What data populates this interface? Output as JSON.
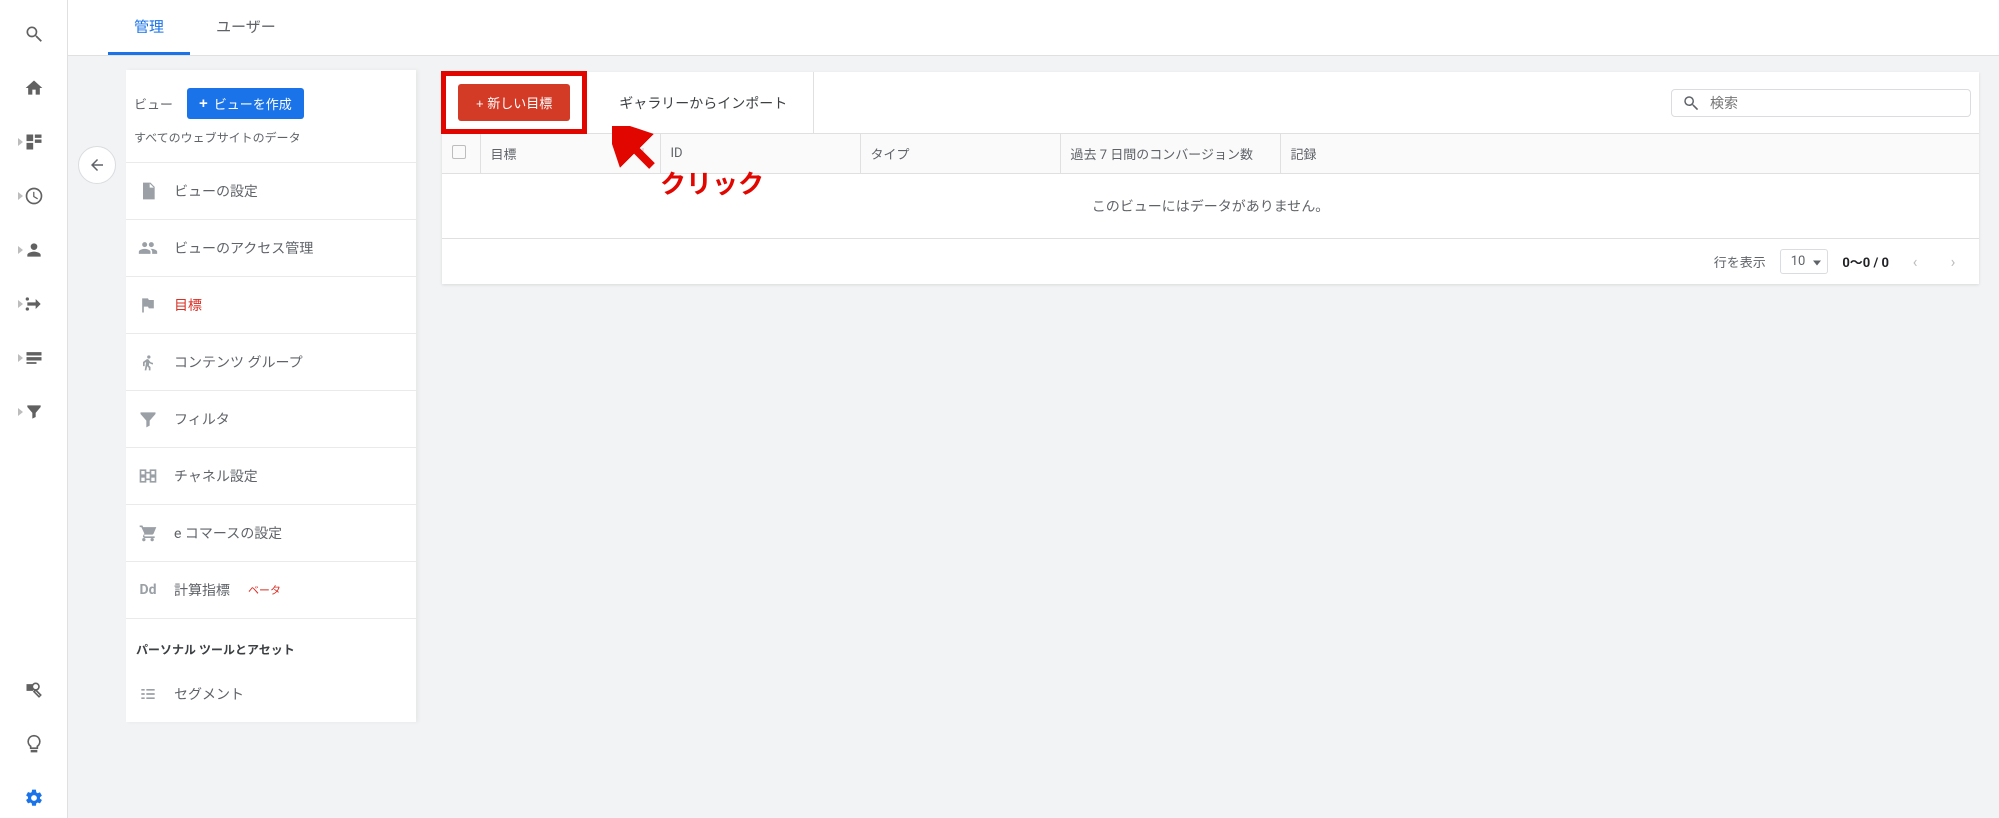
{
  "tabs": {
    "admin": "管理",
    "user": "ユーザー"
  },
  "rail": {
    "search": "search",
    "home": "home",
    "custom": "customization",
    "realtime": "realtime",
    "audience": "audience",
    "acquisition": "acquisition",
    "behavior": "behavior",
    "conversions": "conversions",
    "discover": "discover",
    "insights": "insights",
    "admin": "admin"
  },
  "side": {
    "view_label": "ビュー",
    "create_view": "ビューを作成",
    "subtitle": "すべてのウェブサイトのデータ",
    "items": [
      {
        "label": "ビューの設定"
      },
      {
        "label": "ビューのアクセス管理"
      },
      {
        "label": "目標"
      },
      {
        "label": "コンテンツ グループ"
      },
      {
        "label": "フィルタ"
      },
      {
        "label": "チャネル設定"
      },
      {
        "label": "e コマースの設定"
      },
      {
        "label": "計算指標",
        "beta": "ベータ"
      }
    ],
    "section_personal": "パーソナル ツールとアセット",
    "segments": "セグメント"
  },
  "toolbar": {
    "new_goal": "+ 新しい目標",
    "import": "ギャラリーからインポート",
    "search_placeholder": "検索"
  },
  "table": {
    "cols": {
      "goal": "目標",
      "id": "ID",
      "type": "タイプ",
      "conv": "過去 7 日間のコンバージョン数",
      "rec": "記録"
    },
    "empty": "このビューにはデータがありません。"
  },
  "pager": {
    "rows_label": "行を表示",
    "rows_value": "10",
    "range": "0～0 / 0"
  },
  "annotation": {
    "label": "クリック"
  }
}
